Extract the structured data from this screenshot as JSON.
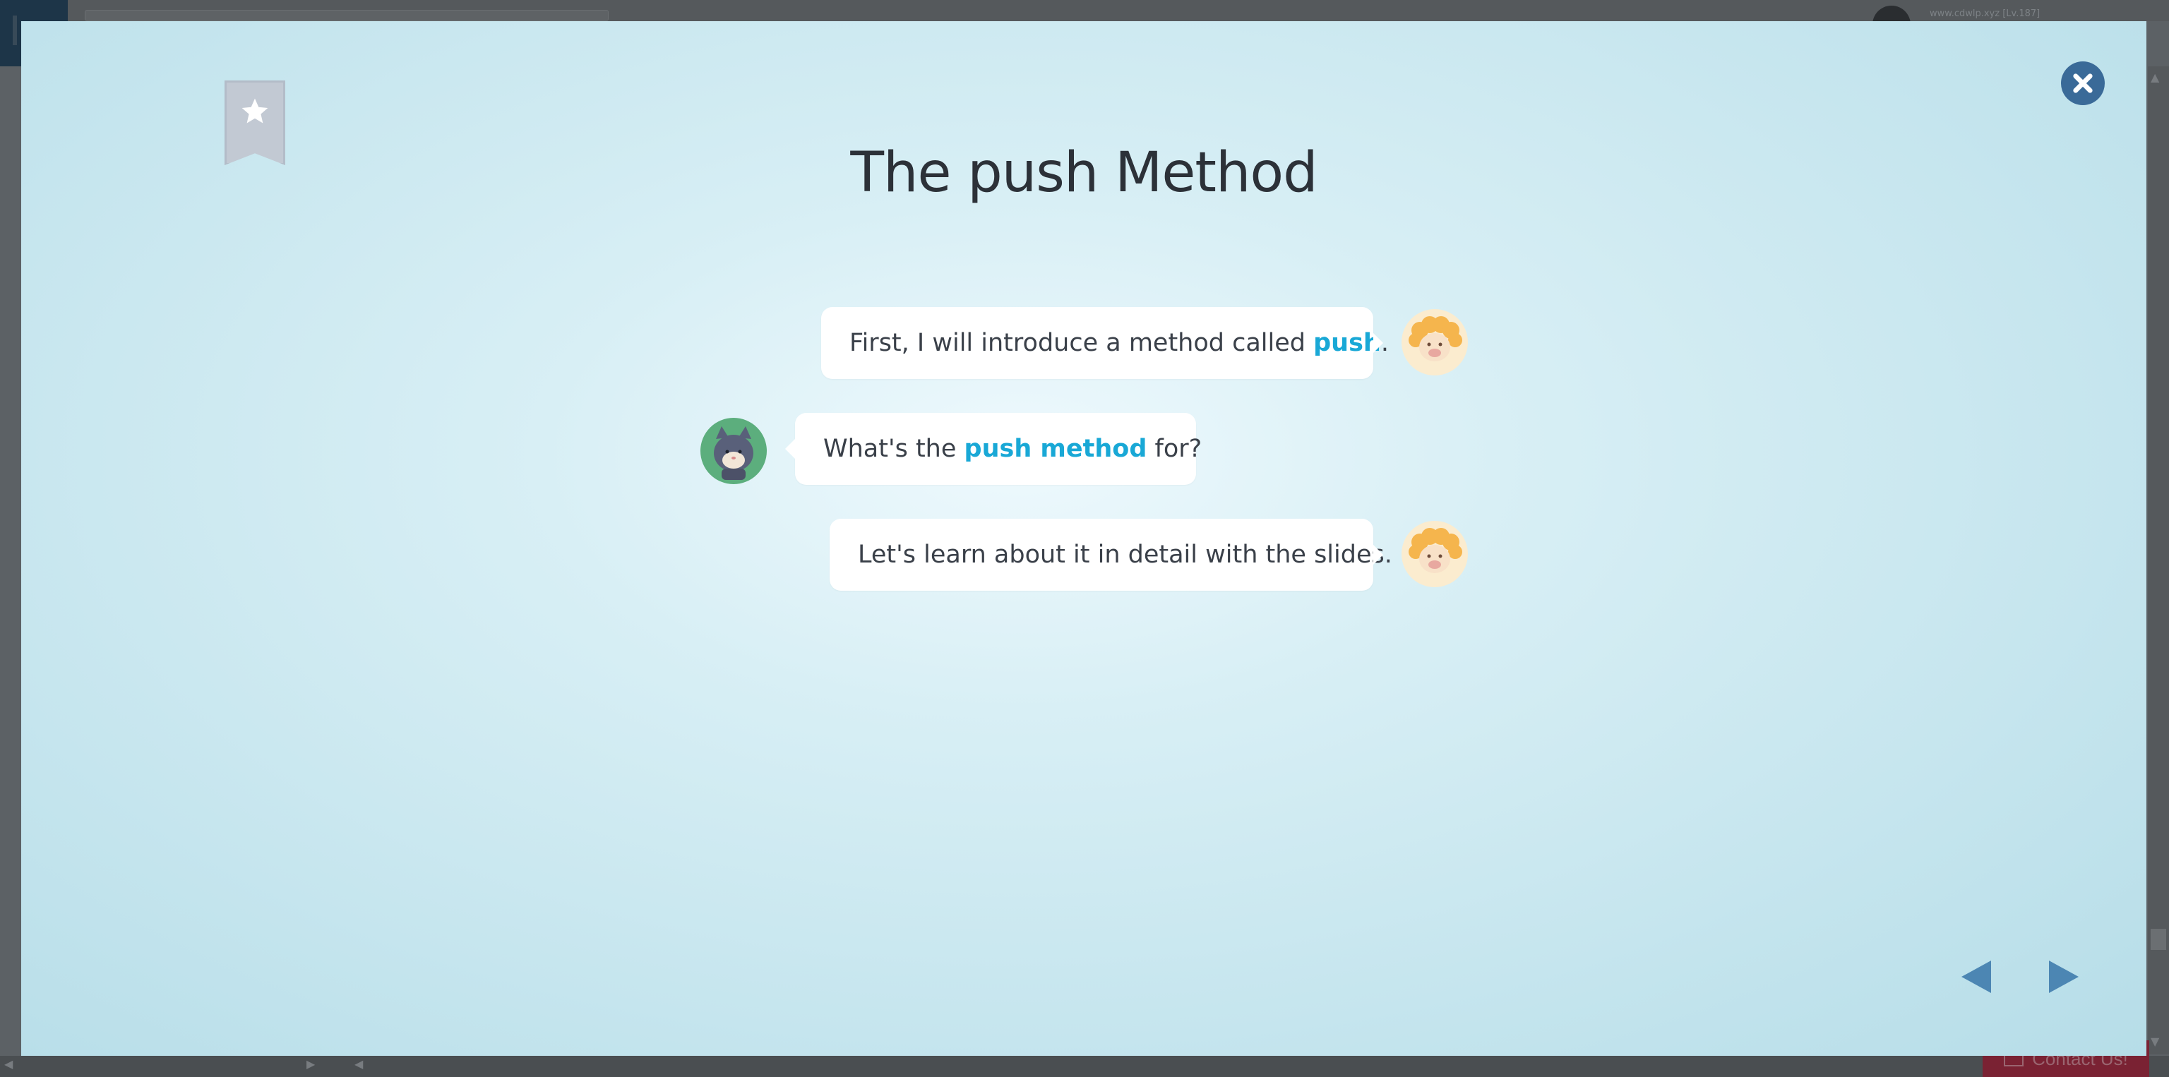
{
  "background": {
    "profile_text": "www.cdwlp.xyz [Lv.187]",
    "contact_label": "Contact Us!"
  },
  "modal": {
    "title": "The push Method",
    "bookmark_icon": "star-icon",
    "close_icon": "close-icon"
  },
  "dialogue": [
    {
      "speaker": "sheep",
      "parts": [
        {
          "text": "First, I will introduce a method called ",
          "highlight": false
        },
        {
          "text": "push",
          "highlight": true
        },
        {
          "text": ".",
          "highlight": false
        }
      ]
    },
    {
      "speaker": "cat",
      "parts": [
        {
          "text": "What's the ",
          "highlight": false
        },
        {
          "text": "push method",
          "highlight": true
        },
        {
          "text": " for?",
          "highlight": false
        }
      ]
    },
    {
      "speaker": "sheep",
      "parts": [
        {
          "text": "Let's learn about it in detail with the slides.",
          "highlight": false
        }
      ]
    }
  ],
  "navigation": {
    "prev_icon": "triangle-left-icon",
    "next_icon": "triangle-right-icon"
  },
  "colors": {
    "keyword": "#19a8d6",
    "close_button": "#3a6a98",
    "nav_arrow": "#4c86b3"
  }
}
